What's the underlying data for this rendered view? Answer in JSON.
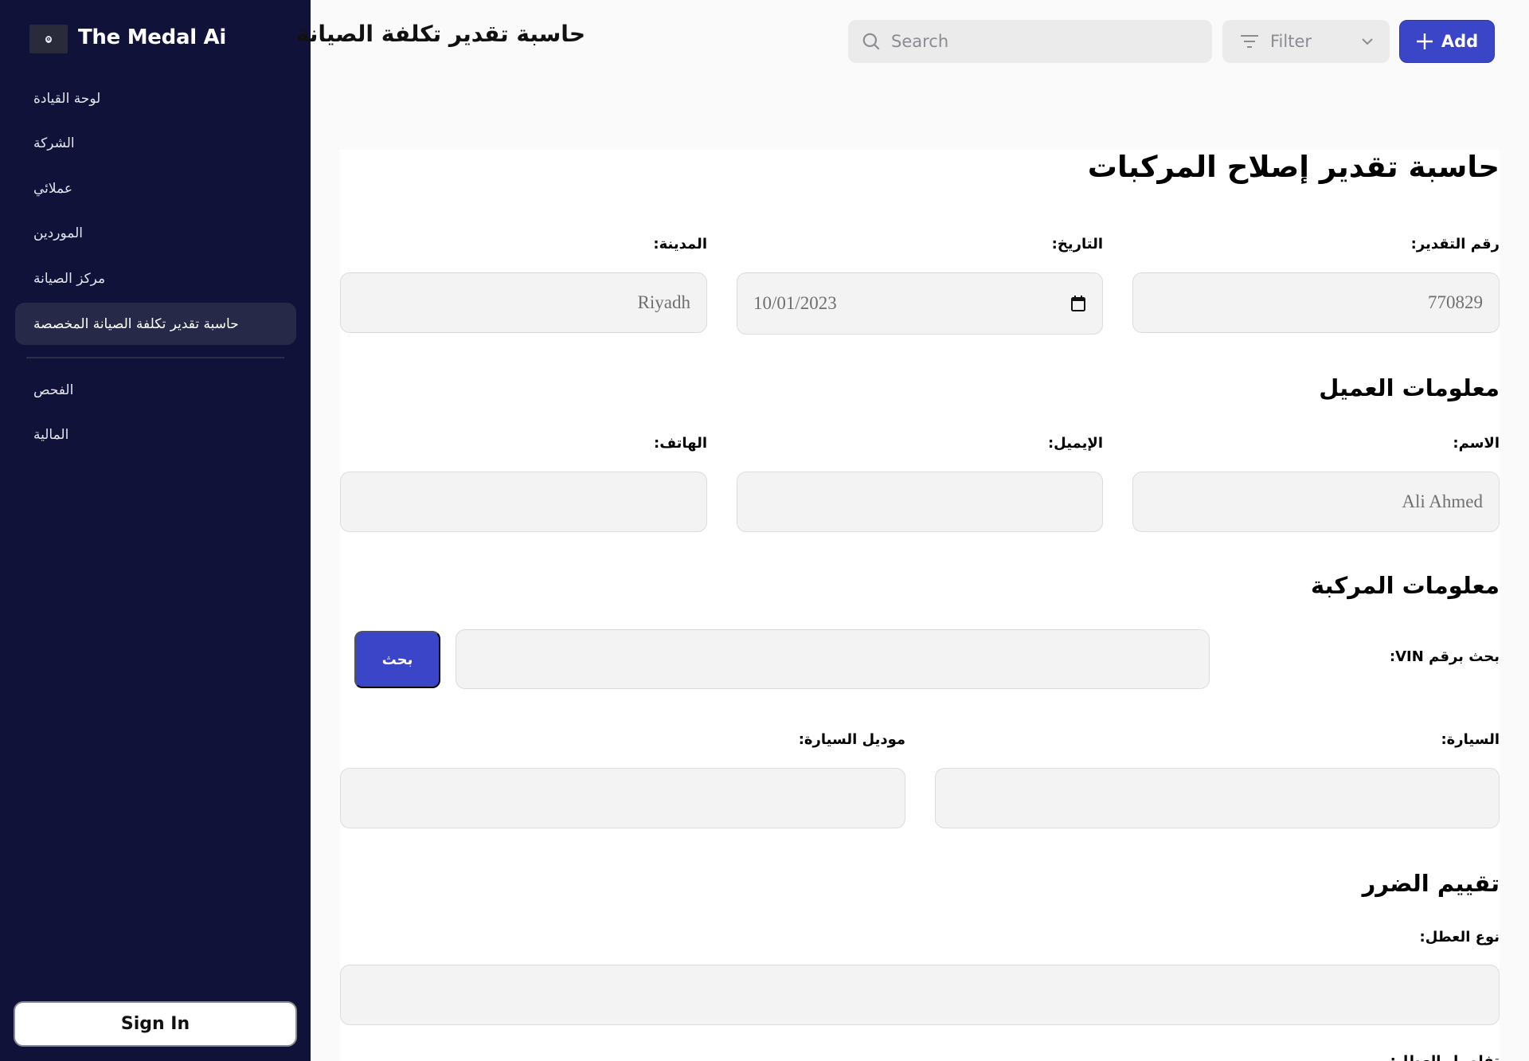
{
  "app": {
    "brand": "The Medal Ai",
    "logo_glyph": "o"
  },
  "sidebar": {
    "items": [
      {
        "label": "لوحة القيادة",
        "active": false
      },
      {
        "label": "الشركة",
        "active": false
      },
      {
        "label": "عملائي",
        "active": false
      },
      {
        "label": "الموردين",
        "active": false
      },
      {
        "label": "مركز الصيانة",
        "active": false
      },
      {
        "label": "حاسبة تقدير تكلفة الصيانة المخصصة",
        "active": true
      },
      {
        "label": "الفحص",
        "active": false
      },
      {
        "label": "المالية",
        "active": false
      }
    ],
    "sign_in_label": "Sign In"
  },
  "header": {
    "title": "حاسبة تقدير تكلفة الصيانة",
    "search_placeholder": "Search",
    "filter_label": "Filter",
    "add_label": "Add"
  },
  "form": {
    "title": "حاسبة تقدير إصلاح المركبات",
    "estimate_number": {
      "label": "رقم التقدير:",
      "value": "770829"
    },
    "date": {
      "label": "التاريخ:",
      "value": "10/01/2023"
    },
    "city": {
      "label": "المدينة:",
      "value": "Riyadh"
    },
    "customer_section": "معلومات العميل",
    "name": {
      "label": "الاسم:",
      "value": "Ali Ahmed"
    },
    "email": {
      "label": "الإيميل:",
      "value": ""
    },
    "phone": {
      "label": "الهاتف:",
      "value": ""
    },
    "vehicle_section": "معلومات المركبة",
    "vin": {
      "label": "بحث برقم VIN:",
      "value": "",
      "button": "بحث"
    },
    "car": {
      "label": "السيارة:",
      "value": ""
    },
    "car_model": {
      "label": "موديل السيارة:",
      "value": ""
    },
    "damage_section": "تقييم الضرر",
    "fault_type": {
      "label": "نوع العطل:",
      "value": ""
    },
    "fault_details": {
      "label": "تفاصيل العطل:"
    }
  },
  "colors": {
    "sidebar_bg": "#10123a",
    "sidebar_active": "#262947",
    "accent": "#3b45c8",
    "input_bg": "#f3f3f3"
  }
}
